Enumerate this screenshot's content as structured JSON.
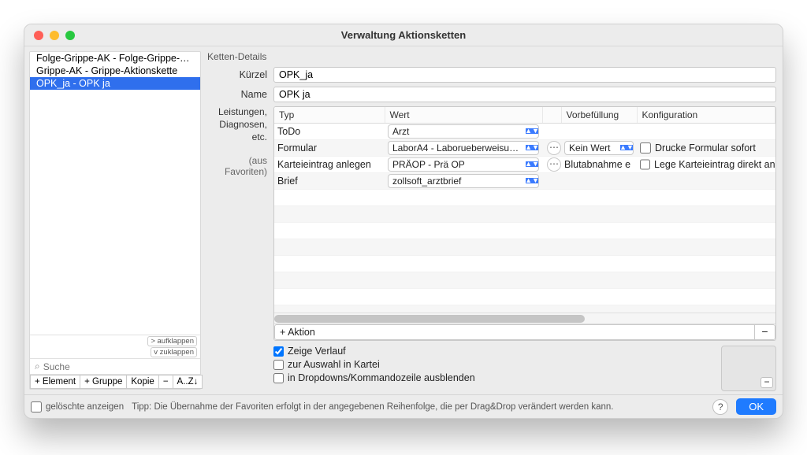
{
  "window": {
    "title": "Verwaltung Aktionsketten"
  },
  "sidebar": {
    "items": [
      {
        "label": "Folge-Grippe-AK - Folge-Grippe-Akt...",
        "selected": false
      },
      {
        "label": "Grippe-AK - Grippe-Aktionskette",
        "selected": false
      },
      {
        "label": "OPK_ja - OPK ja",
        "selected": true
      }
    ],
    "expand": "> aufklappen",
    "collapse": "v zuklappen",
    "search_placeholder": "Suche",
    "buttons": {
      "addElement": "+ Element",
      "addGroup": "+ Gruppe",
      "copy": "Kopie",
      "remove": "−",
      "sort": "A..Z↓"
    }
  },
  "details": {
    "group_label": "Ketten-Details",
    "labels": {
      "kurzel": "Kürzel",
      "name": "Name",
      "leistungen1": "Leistungen,",
      "leistungen2": "Diagnosen,",
      "leistungen3": "etc.",
      "favoriten": "(aus Favoriten)"
    },
    "kurzel": "OPK_ja",
    "name": "OPK ja",
    "columns": {
      "typ": "Typ",
      "wert": "Wert",
      "vorb": "Vorbefüllung",
      "konf": "Konfiguration"
    },
    "rows": [
      {
        "typ": "ToDo",
        "wert": "Arzt",
        "wert_style": "combo",
        "action": "",
        "vorb": "",
        "konf_chk": false,
        "konf_label": ""
      },
      {
        "typ": "Formular",
        "wert": "LaborA4 - Laborueberweisun…",
        "wert_style": "combo",
        "action": "dots",
        "vorb": "Kein Wert",
        "vorb_style": "combo",
        "konf_chk": true,
        "konf_label": "Drucke Formular sofort"
      },
      {
        "typ": "Karteieintrag anlegen",
        "wert": "PRÄOP - Prä OP",
        "wert_style": "combo",
        "action": "dots",
        "vorb": "Blutabnahme e",
        "konf_chk": true,
        "konf_label": "Lege Karteieintrag direkt an (zeige k"
      },
      {
        "typ": "Brief",
        "wert": "zollsoft_arztbrief",
        "wert_style": "combo",
        "action": "",
        "vorb": "",
        "konf_chk": false,
        "konf_label": ""
      }
    ],
    "add_label": "+ Aktion",
    "minus": "−",
    "checks": {
      "zeige": "Zeige Verlauf",
      "auswahl": "zur Auswahl in Kartei",
      "dropdown": "in Dropdowns/Kommandozeile ausblenden"
    }
  },
  "footer": {
    "deleted": "gelöschte anzeigen",
    "tip": "Tipp: Die Übernahme der Favoriten erfolgt in der angegebenen Reihenfolge, die per Drag&Drop verändert werden kann.",
    "help": "?",
    "ok": "OK"
  }
}
